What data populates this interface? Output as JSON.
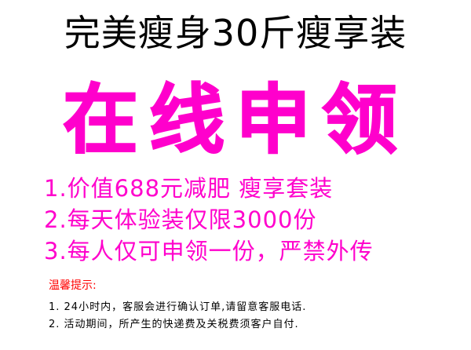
{
  "headline": "完美瘦身30斤瘦享装",
  "cta": "在线申领",
  "benefits": [
    "1.价值688元减肥 瘦享套装",
    "2.每天体验装仅限3000份",
    "3.每人仅可申领一份，严禁外传"
  ],
  "tips": {
    "title": "温馨提示:",
    "items": [
      "1. 24小时内，客服会进行确认订单,请留意客服电话.",
      "2. 活动期间，所产生的快递费及关税费须客户自付."
    ]
  },
  "colors": {
    "accent": "#ff00cc",
    "tips_title": "#ff0000",
    "text": "#000000",
    "background": "#ffffff"
  }
}
